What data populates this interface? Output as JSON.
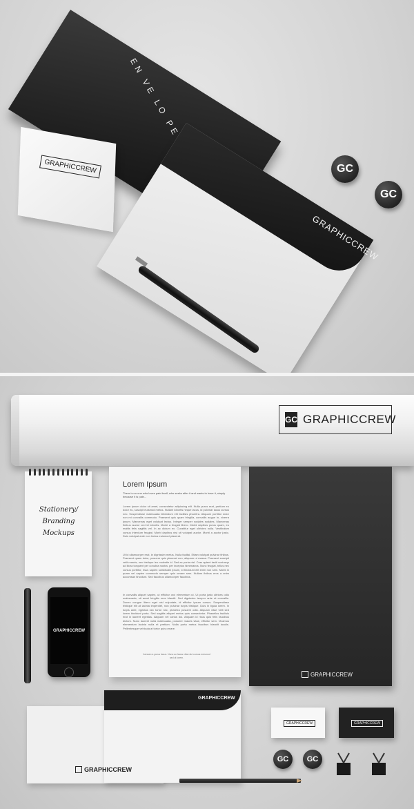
{
  "top_scene": {
    "envelope_box_word": "EN VE LO PE",
    "business_card_brand": "GRAPHICCREW",
    "envelope_flap_brand": "GRAPHICCREW",
    "badge_mark": "GC"
  },
  "bottom_scene": {
    "tube_brand": "GRAPHICCREW",
    "tube_mark": "GC",
    "notepad_text": "Stationery/ Branding Mockups",
    "letter": {
      "title": "Lorem Ipsum",
      "subtitle": "There is no one who loves pain itself, who seeks after it and wants to have it, simply because it is pain...",
      "paragraph_1": "Lorem ipsum dolor sit amet, consectetur adipiscing elit. Nulla purus erat, pretium eu dolor eu, suscipit euismod metus. Nullam lobortis neque lacus, id pulvinar lacus cursus nec. Suspendisse malesuada bibendum elit facilisis pharetra. Aliquam porttitor dolor non mi convallis commodo. Praesent quis quam fringilla, convallis augue in, viverra ipsum. Maecenas eget volutpat lectus. Integer semper sodales sodales. Maecenas finibus auctor orci id lobortis. Morbi a feugiat libero. Morbi dapibus purus quam, eu mattis felis sagittis vel. In ac dictum ex. Curabitur eget ultricies nulla. Vestibulum cursus interdum feugiat. Morbi dapibus nisi sit volutpat auctor. Morbi a auctor justo. Duis volutpat ante non lectus euismod placerat.",
      "paragraph_2": "Ut id ullamcorper erat, in dignissim metus. Nulla facilisi. Etiam volutpat pulvinar finibus. Praesent quam dolor, posuere quis placerat non, aliquam ut massa. Praesent suscipit velit mauris, nec tristique leo molestie id. Sed ac porta nisl. Cras aptent taciti sociosqu ad litora torquent per conubia nostra, per inceptos himenaeos. Nunc feugiat, tellus nec cursus porttitor, risus sapien sollicitudin ipsum, id tincidunt elit enim non sem. Morbi in quam vel sapien commodo semper quis ornare sem. Nullam finibus eros a enim accumsan tincidunt. Sed faucibus ullamcorper faucibus.",
      "paragraph_3": "In convallis aliquet sapien, ut efficitur orci elementum ut. Ut porta justo ultrices odio malesuada, sit amet fringilla eros blandit. Sed dignissim tempor ante at convallis. Donec congue libero eget nisl vulputate, id efficitur ipsum cursus. Suspendisse tristique elit at lacinia imperdiet, non pulvinar turpis tristique. Duis in ligula lorem. In turpis ante, egestas nec tortor nec, pharetra posuere odio. Aliquam vitae velit sed lorem tincidunt porta. Sed sagittis aliquet metus quis consectetur. Phasellus facilisis erat in laoreet egestas. Aliquam vel varius dui. Aliquam id risus quis felis faucibus dictum. Nunc laoreet nulla malesuada, posuere mauris vitae, efficitur sem. Vivamus elementum lacinia nulla et pretium. Nulla porta metus faucibus blandit iaculis. Pellentesque vehicula at tortor quis ornare.",
      "footer": "Aenean a purus lacus. Nunc ac lacus vitae dui cursus euismod sed ut lorem."
    },
    "folder_brand": "GRAPHICCREW",
    "phone_brand": "GRAPHICCREW",
    "envelope_flap_brand": "GRAPHICCREW",
    "letterhead_brand": "GRAPHICCREW",
    "card_white_brand": "GRAPHICCREW",
    "card_black_brand": "GRAPHICCREW",
    "badge_mark": "GC"
  }
}
